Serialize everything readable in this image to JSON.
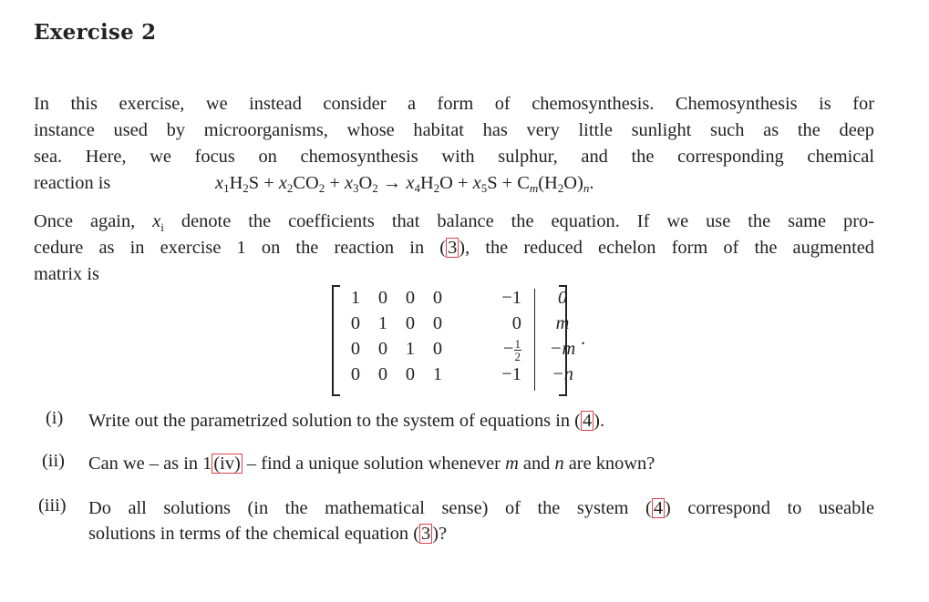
{
  "heading": "Exercise 2",
  "intro": {
    "lines": [
      "In this exercise, we instead consider a form of chemosynthesis. Chemosynthesis is for",
      "instance used by microorganisms, whose habitat has very little sunlight such as the deep",
      "sea. Here, we focus on chemosynthesis with sulphur, and the corresponding chemical",
      "reaction is"
    ]
  },
  "equation": {
    "terms": [
      {
        "coef": "x",
        "coef_sub": "1",
        "species": "H",
        "sub": "2",
        "tail": "S"
      },
      {
        "coef": "x",
        "coef_sub": "2",
        "species": "CO",
        "sub": "2",
        "tail": ""
      },
      {
        "coef": "x",
        "coef_sub": "3",
        "species": "O",
        "sub": "2",
        "tail": ""
      },
      {
        "coef": "x",
        "coef_sub": "4",
        "species": "H",
        "sub": "2",
        "tail": "O"
      },
      {
        "coef": "x",
        "coef_sub": "5",
        "species": "S",
        "sub": "",
        "tail": ""
      }
    ],
    "plus": "+",
    "arrow": "→",
    "last_term": {
      "c": "C",
      "c_sub": "m",
      "open": "(H",
      "h_sub": "2",
      "close": "O)",
      "n_sub": "n"
    },
    "end": "."
  },
  "para2": {
    "line1_a": "Once again, ",
    "line1_var": "x",
    "line1_var_sub": "i",
    "line1_b": " denote the coefficients that balance the equation. If we use the same pro-",
    "line2_a": "cedure as in exercise 1 on the reaction in (",
    "line2_ref": "3",
    "line2_b": "), the reduced echelon form of the augmented",
    "line3": "matrix is"
  },
  "matrix": {
    "rows": [
      [
        "1",
        "0",
        "0",
        "0",
        "−1",
        "0"
      ],
      [
        "0",
        "1",
        "0",
        "0",
        "0",
        "m"
      ],
      [
        "0",
        "0",
        "1",
        "0",
        "−½",
        "−m"
      ],
      [
        "0",
        "0",
        "0",
        "1",
        "−1",
        "−n"
      ]
    ],
    "half_num": "1",
    "half_den": "2",
    "minus": "−",
    "end": "."
  },
  "items": [
    {
      "label": "(i)",
      "a": "Write out the parametrized solution to the system of equations in (",
      "ref": "4",
      "b": ")."
    },
    {
      "label": "(ii)",
      "a": "Can we – as in 1",
      "ref": "(iv)",
      "b": " – find a unique solution whenever ",
      "m": "m",
      "c": " and ",
      "n": "n",
      "d": " are known?"
    },
    {
      "label": "(iii)",
      "a": "Do all solutions (in the mathematical sense) of the system (",
      "ref": "4",
      "b": ") correspond to useable",
      "line2_a": "solutions in terms of the chemical equation (",
      "ref2": "3",
      "line2_b": ")?"
    }
  ],
  "colors": {
    "ref_box": "#e0404a",
    "text": "#222222"
  }
}
